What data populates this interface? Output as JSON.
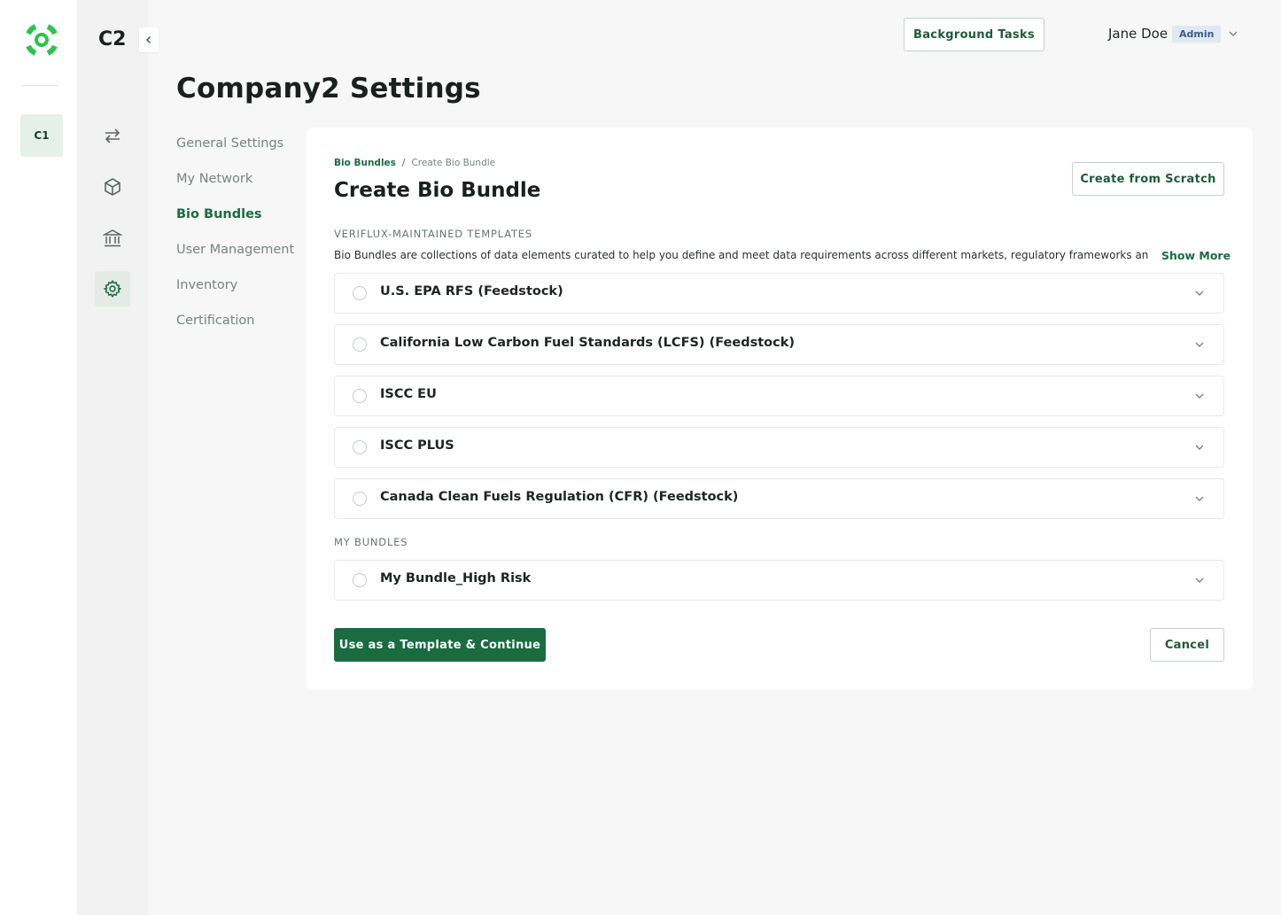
{
  "rail": {
    "org_tile": "C1",
    "logo_color": "#2fc24d"
  },
  "sidebar": {
    "org_code": "C2",
    "icons": [
      "swap-icon",
      "cube-icon",
      "bank-icon",
      "gear-icon"
    ],
    "active_icon": "gear-icon"
  },
  "header": {
    "background_tasks": "Background Tasks",
    "user_name": "Jane Doe",
    "role_badge": "Admin"
  },
  "page": {
    "title": "Company2 Settings"
  },
  "settings_menu": {
    "items": [
      {
        "label": "General Settings"
      },
      {
        "label": "My Network"
      },
      {
        "label": "Bio Bundles"
      },
      {
        "label": "User Management"
      },
      {
        "label": "Inventory"
      },
      {
        "label": "Certification"
      }
    ],
    "active": "Bio Bundles"
  },
  "card": {
    "breadcrumb": {
      "parent": "Bio Bundles",
      "separator": "/",
      "current": "Create Bio Bundle"
    },
    "title": "Create Bio Bundle",
    "create_scratch": "Create from Scratch",
    "templates_label": "VERIFLUX-MAINTAINED TEMPLATES",
    "description": "Bio Bundles are collections of data elements curated to help you define and meet data requirements across different markets, regulatory frameworks and...",
    "show_more": "Show More",
    "templates": [
      {
        "label": "U.S. EPA RFS (Feedstock)"
      },
      {
        "label": "California Low Carbon Fuel Standards (LCFS) (Feedstock)"
      },
      {
        "label": "ISCC EU"
      },
      {
        "label": "ISCC PLUS"
      },
      {
        "label": "Canada Clean Fuels Regulation (CFR) (Feedstock)"
      }
    ],
    "my_bundles_label": "MY BUNDLES",
    "my_bundles": [
      {
        "label": "My Bundle_High Risk"
      }
    ],
    "primary_action": "Use as a Template & Continue",
    "cancel": "Cancel"
  },
  "colors": {
    "brand_green": "#1b6b41",
    "page_bg": "#f6f7f6"
  }
}
